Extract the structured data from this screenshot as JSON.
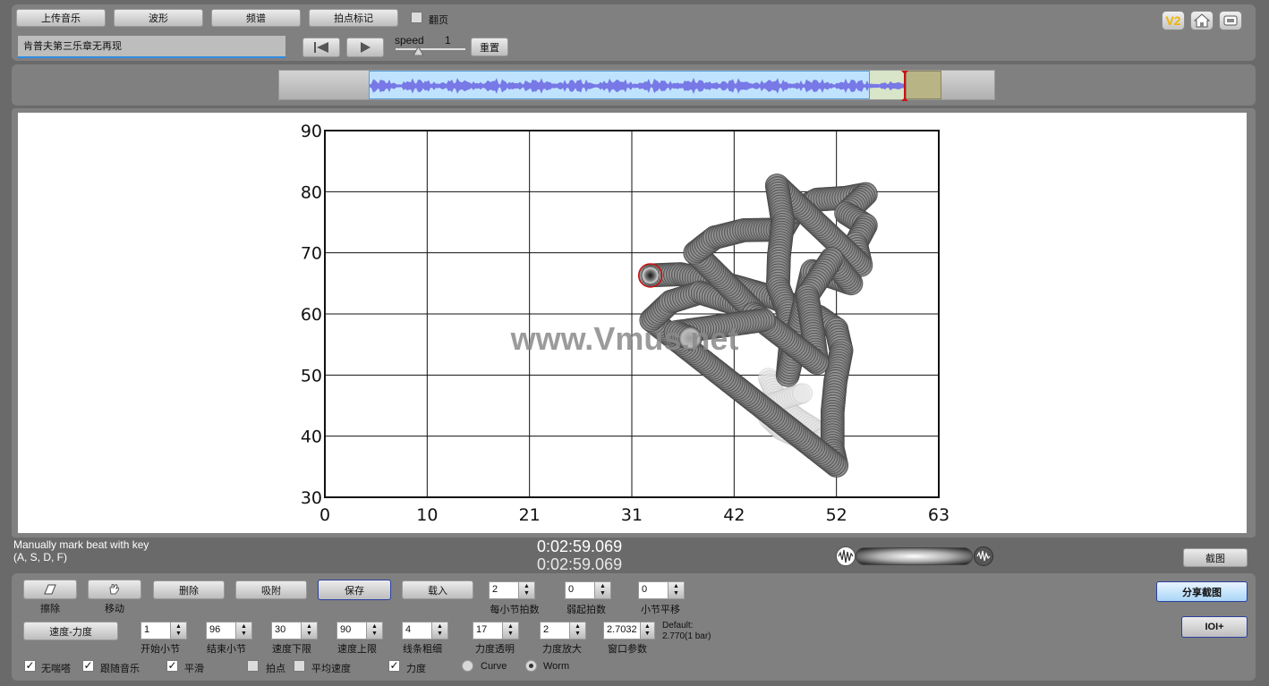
{
  "toolbar": {
    "upload_label": "上传音乐",
    "waveform_label": "波形",
    "spectrum_label": "频谱",
    "beat_mark_label": "拍点标记",
    "page_flip_label": "翻页",
    "track_title": "肯普夫第三乐章无再现",
    "speed_label": "speed",
    "speed_value": "1",
    "reset_label": "重置",
    "v2_label": "V2"
  },
  "chart_data": {
    "type": "scatter",
    "xlim": [
      0,
      63
    ],
    "ylim": [
      30,
      90
    ],
    "x_ticks": [
      "0",
      "10",
      "21",
      "31",
      "42",
      "52",
      "63"
    ],
    "y_ticks": [
      "90",
      "80",
      "70",
      "60",
      "50",
      "40",
      "30"
    ],
    "grid": true,
    "watermark": "www.Vmus.net",
    "points": [
      [
        33.4,
        66.3
      ],
      [
        36.5,
        66.5
      ],
      [
        40.0,
        65.4
      ],
      [
        43.0,
        64.1
      ],
      [
        46.0,
        62.7
      ],
      [
        48.3,
        61.2
      ],
      [
        50.7,
        59.5
      ],
      [
        52.5,
        57.5
      ],
      [
        53.0,
        54.0
      ],
      [
        52.4,
        49.0
      ],
      [
        52.1,
        44.0
      ],
      [
        52.1,
        38.0
      ],
      [
        52.5,
        35.2
      ],
      [
        33.5,
        59.0
      ],
      [
        35.5,
        62.0
      ],
      [
        38.5,
        63.5
      ],
      [
        41.5,
        62.0
      ],
      [
        44.0,
        60.5
      ],
      [
        38.0,
        70.0
      ],
      [
        40.0,
        72.5
      ],
      [
        43.0,
        73.7
      ],
      [
        47.0,
        73.8
      ],
      [
        48.0,
        76.5
      ],
      [
        50.5,
        78.7
      ],
      [
        53.5,
        79.0
      ],
      [
        55.5,
        79.6
      ],
      [
        53.5,
        76.5
      ],
      [
        55.5,
        74.5
      ],
      [
        54.5,
        71.5
      ],
      [
        55.0,
        68.0
      ],
      [
        46.4,
        81.0
      ],
      [
        47.0,
        75.0
      ],
      [
        46.6,
        69.5
      ],
      [
        46.5,
        64.5
      ],
      [
        47.5,
        60.5
      ],
      [
        47.8,
        55.0
      ],
      [
        47.5,
        50.0
      ],
      [
        50.0,
        67.0
      ],
      [
        52.2,
        66.0
      ],
      [
        54.0,
        65.0
      ],
      [
        52.0,
        69.0
      ],
      [
        49.5,
        63.0
      ],
      [
        50.0,
        58.0
      ],
      [
        50.5,
        52.0
      ],
      [
        44.0,
        60.0
      ],
      [
        45.0,
        59.0
      ],
      [
        36.0,
        57.0
      ],
      [
        37.5,
        56.0
      ]
    ],
    "faded_points": [
      [
        45.5,
        49.5
      ],
      [
        46.3,
        46.5
      ],
      [
        47.3,
        44.5
      ],
      [
        48.5,
        43.0
      ],
      [
        50.0,
        41.5
      ],
      [
        51.3,
        40.0
      ],
      [
        50.0,
        38.5
      ],
      [
        48.2,
        40.0
      ],
      [
        46.8,
        41.0
      ],
      [
        45.5,
        43.0
      ],
      [
        46.0,
        45.5
      ],
      [
        49.0,
        47.0
      ]
    ],
    "current_point": [
      33.4,
      66.3
    ]
  },
  "status": {
    "hint_line1": "Manually mark beat with key",
    "hint_line2": "(A, S, D, F)",
    "time_current": "0:02:59.069",
    "time_total": "0:02:59.069",
    "screenshot_label": "截图",
    "share_screenshot_label": "分享截图",
    "ioi_label": "IOI+"
  },
  "controls": {
    "erase_label": "擦除",
    "move_label": "移动",
    "delete_label": "删除",
    "snap_label": "吸附",
    "save_label": "保存",
    "load_label": "载入",
    "beats_per_bar": {
      "value": "2",
      "label": "每小节拍数"
    },
    "pickup_beats": {
      "value": "0",
      "label": "弱起拍数"
    },
    "bar_shift": {
      "value": "0",
      "label": "小节平移"
    },
    "mode_label": "速度-力度",
    "start_bar": {
      "value": "1",
      "label": "开始小节"
    },
    "end_bar": {
      "value": "96",
      "label": "结束小节"
    },
    "tempo_min": {
      "value": "30",
      "label": "速度下限"
    },
    "tempo_max": {
      "value": "90",
      "label": "速度上限"
    },
    "line_width": {
      "value": "4",
      "label": "线条粗细"
    },
    "dynamics_fade": {
      "value": "17",
      "label": "力度透明"
    },
    "dynamics_scale": {
      "value": "2",
      "label": "力度放大"
    },
    "window_param": {
      "value": "2.7032",
      "label": "窗口参数"
    },
    "default_line1": "Default:",
    "default_line2": "2.770(1 bar)",
    "no_breath_label": "无喘嗒",
    "follow_music_label": "跟随音乐",
    "smooth_label": "平滑",
    "beat_point_label": "拍点",
    "avg_tempo_label": "平均速度",
    "dynamics_label": "力度",
    "curve_label": "Curve",
    "worm_label": "Worm"
  },
  "colors": {
    "accent_blue": "#2b3f9e",
    "waveform": "#7878e6",
    "selection": "#bfe3ff",
    "playhead": "#cc1111"
  }
}
